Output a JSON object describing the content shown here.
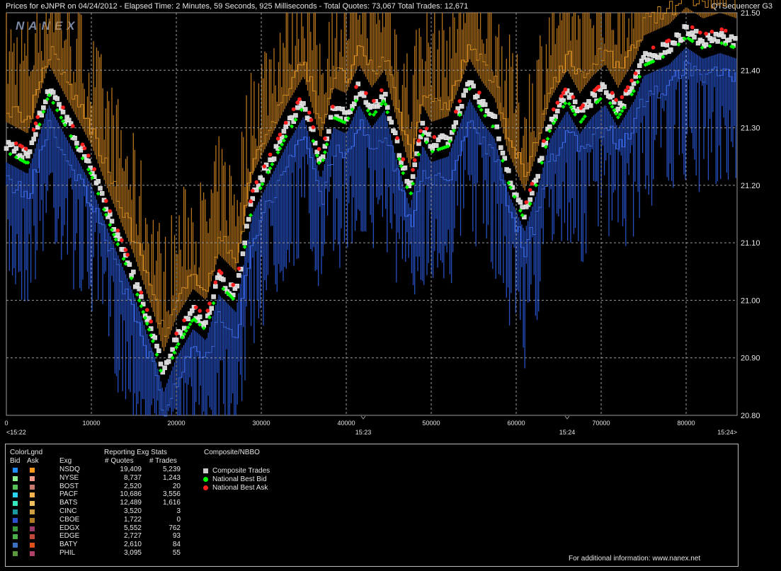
{
  "header": {
    "title": "Prices for  eJNPR  on  04/24/2012  -  Elapsed Time: 2 Minutes, 59 Seconds, 925 Milliseconds  -  Total Quotes: 73,067  Total Trades: 12,671",
    "app": "QTSequencer G3"
  },
  "watermark": "NANEX",
  "chart_data": {
    "type": "scatter",
    "xlim": [
      0,
      86000
    ],
    "ylim": [
      20.8,
      21.5
    ],
    "y_ticks": [
      "21.50",
      "21.40",
      "21.30",
      "21.20",
      "21.10",
      "21.00",
      "20.90",
      "20.80"
    ],
    "x_ticks": [
      "0",
      "10000",
      "20000",
      "30000",
      "40000",
      "50000",
      "60000",
      "70000",
      "80000"
    ],
    "time_labels": [
      {
        "x": 0,
        "label": "<15:22"
      },
      {
        "x": 42000,
        "label": "15:23"
      },
      {
        "x": 66000,
        "label": "15:24"
      },
      {
        "x": 86000,
        "label": "15:24>"
      }
    ],
    "grid": true,
    "price_path": {
      "x": [
        0,
        2500,
        5000,
        7500,
        10000,
        12000,
        15000,
        17500,
        18500,
        20000,
        22000,
        23500,
        25000,
        27000,
        28000,
        29000,
        31000,
        33000,
        35000,
        37000,
        38500,
        40000,
        41500,
        43000,
        44500,
        46000,
        47500,
        49000,
        50000,
        52000,
        54500,
        56000,
        57500,
        59000,
        61000,
        62500,
        64000,
        66000,
        67500,
        69000,
        70500,
        72000,
        74000,
        75000,
        76500,
        78000,
        80000,
        82000,
        84000,
        86000
      ],
      "y": [
        21.27,
        21.25,
        21.37,
        21.3,
        21.23,
        21.15,
        21.04,
        20.93,
        20.87,
        20.93,
        20.98,
        20.96,
        21.04,
        21.01,
        21.1,
        21.18,
        21.24,
        21.3,
        21.35,
        21.24,
        21.33,
        21.32,
        21.37,
        21.33,
        21.36,
        21.27,
        21.19,
        21.3,
        21.27,
        21.28,
        21.38,
        21.34,
        21.31,
        21.22,
        21.15,
        21.22,
        21.31,
        21.36,
        21.32,
        21.35,
        21.37,
        21.33,
        21.38,
        21.42,
        21.43,
        21.44,
        21.47,
        21.45,
        21.46,
        21.45
      ]
    },
    "series": [
      {
        "name": "Composite Trades",
        "color": "#c8c8c8",
        "marker": "square"
      },
      {
        "name": "National Best Bid",
        "color": "#00ff00",
        "marker": "diamond"
      },
      {
        "name": "National Best Ask",
        "color": "#ff2020",
        "marker": "circle"
      }
    ]
  },
  "legend": {
    "color_title": "ColorLgnd",
    "bid_label": "Bid",
    "ask_label": "Ask",
    "stats_title": "Reporting Exg Stats",
    "exg_label": "Exg",
    "quotes_label": "# Quotes",
    "trades_label": "# Trades",
    "composite_title": "Composite/NBBO",
    "rows": [
      {
        "exg": "NSDQ",
        "quotes": "19,409",
        "trades": "5,239",
        "bid": "#1e90ff",
        "ask": "#ff9a1a"
      },
      {
        "exg": "NYSE",
        "quotes": "8,737",
        "trades": "1,243",
        "bid": "#8cf08c",
        "ask": "#f09a8c"
      },
      {
        "exg": "BOST",
        "quotes": "2,520",
        "trades": "20",
        "bid": "#56c256",
        "ask": "#c87a6e"
      },
      {
        "exg": "PACF",
        "quotes": "10,686",
        "trades": "3,556",
        "bid": "#2ad4f0",
        "ask": "#ffb450"
      },
      {
        "exg": "BATS",
        "quotes": "12,489",
        "trades": "1,616",
        "bid": "#34e8c0",
        "ask": "#f0c060"
      },
      {
        "exg": "CINC",
        "quotes": "3,520",
        "trades": "3",
        "bid": "#1a9aa0",
        "ask": "#d0a040"
      },
      {
        "exg": "CBOE",
        "quotes": "1,722",
        "trades": "0",
        "bid": "#2a50d0",
        "ask": "#b07a20"
      },
      {
        "exg": "EDGX",
        "quotes": "5,552",
        "trades": "762",
        "bid": "#3a9a3a",
        "ask": "#9a3a6a"
      },
      {
        "exg": "EDGE",
        "quotes": "2,727",
        "trades": "93",
        "bid": "#4ab04a",
        "ask": "#c04a3a"
      },
      {
        "exg": "BATY",
        "quotes": "2,610",
        "trades": "84",
        "bid": "#3a70c0",
        "ask": "#e0501a"
      },
      {
        "exg": "PHIL",
        "quotes": "3,095",
        "trades": "55",
        "bid": "#5a9a3a",
        "ask": "#b0406a"
      }
    ],
    "composite_items": [
      {
        "label": "Composite Trades",
        "color": "#c8c8c8",
        "shape": "square"
      },
      {
        "label": "National Best Bid",
        "color": "#00ff00",
        "shape": "dot"
      },
      {
        "label": "National Best Ask",
        "color": "#ff2020",
        "shape": "dot"
      }
    ],
    "footer": "For additional information: www.nanex.net"
  }
}
